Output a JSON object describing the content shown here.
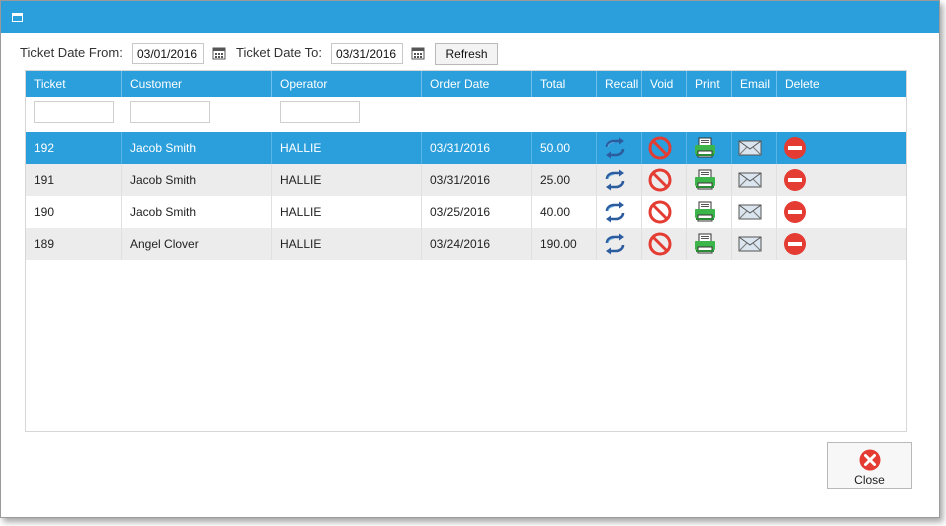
{
  "filters": {
    "from_label": "Ticket Date From:",
    "from_value": "03/01/2016",
    "to_label": "Ticket Date To:",
    "to_value": "03/31/2016",
    "refresh_label": "Refresh"
  },
  "grid": {
    "columns": [
      "Ticket",
      "Customer",
      "Operator",
      "Order Date",
      "Total",
      "Recall",
      "Void",
      "Print",
      "Email",
      "Delete"
    ],
    "rows": [
      {
        "ticket": "192",
        "customer": "Jacob Smith",
        "operator": "HALLIE",
        "order_date": "03/31/2016",
        "total": "50.00"
      },
      {
        "ticket": "191",
        "customer": "Jacob Smith",
        "operator": "HALLIE",
        "order_date": "03/31/2016",
        "total": "25.00"
      },
      {
        "ticket": "190",
        "customer": "Jacob Smith",
        "operator": "HALLIE",
        "order_date": "03/25/2016",
        "total": "40.00"
      },
      {
        "ticket": "189",
        "customer": "Angel Clover",
        "operator": "HALLIE",
        "order_date": "03/24/2016",
        "total": "190.00"
      }
    ],
    "selected_row": 0
  },
  "footer": {
    "close_label": "Close"
  },
  "colors": {
    "accent": "#2a9fdc",
    "alt_row": "#ececec",
    "danger": "#e43b32",
    "print": "#3cb54a"
  },
  "icons": [
    "window-icon",
    "calendar-icon",
    "recall-icon",
    "void-icon",
    "print-icon",
    "email-icon",
    "delete-icon",
    "close-icon"
  ]
}
